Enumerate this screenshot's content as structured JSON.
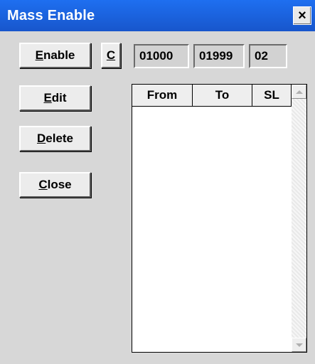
{
  "window": {
    "title": "Mass Enable",
    "close_glyph": "×",
    "titlebar_color": "#1a61dd"
  },
  "buttons": {
    "enable": {
      "accel": "E",
      "rest": "nable"
    },
    "c": {
      "accel": "C",
      "rest": ""
    },
    "edit": {
      "accel": "E",
      "rest": "dit"
    },
    "delete": {
      "accel": "D",
      "rest": "elete"
    },
    "close": {
      "accel": "C",
      "rest": "lose"
    }
  },
  "fields": {
    "from_value": "01000",
    "to_value": "01999",
    "sl_value": "02"
  },
  "table": {
    "columns": [
      "From",
      "To",
      "SL"
    ],
    "rows": []
  },
  "icons": {
    "close": "close-icon",
    "scroll_up": "arrow-up-icon",
    "scroll_down": "arrow-down-icon"
  }
}
